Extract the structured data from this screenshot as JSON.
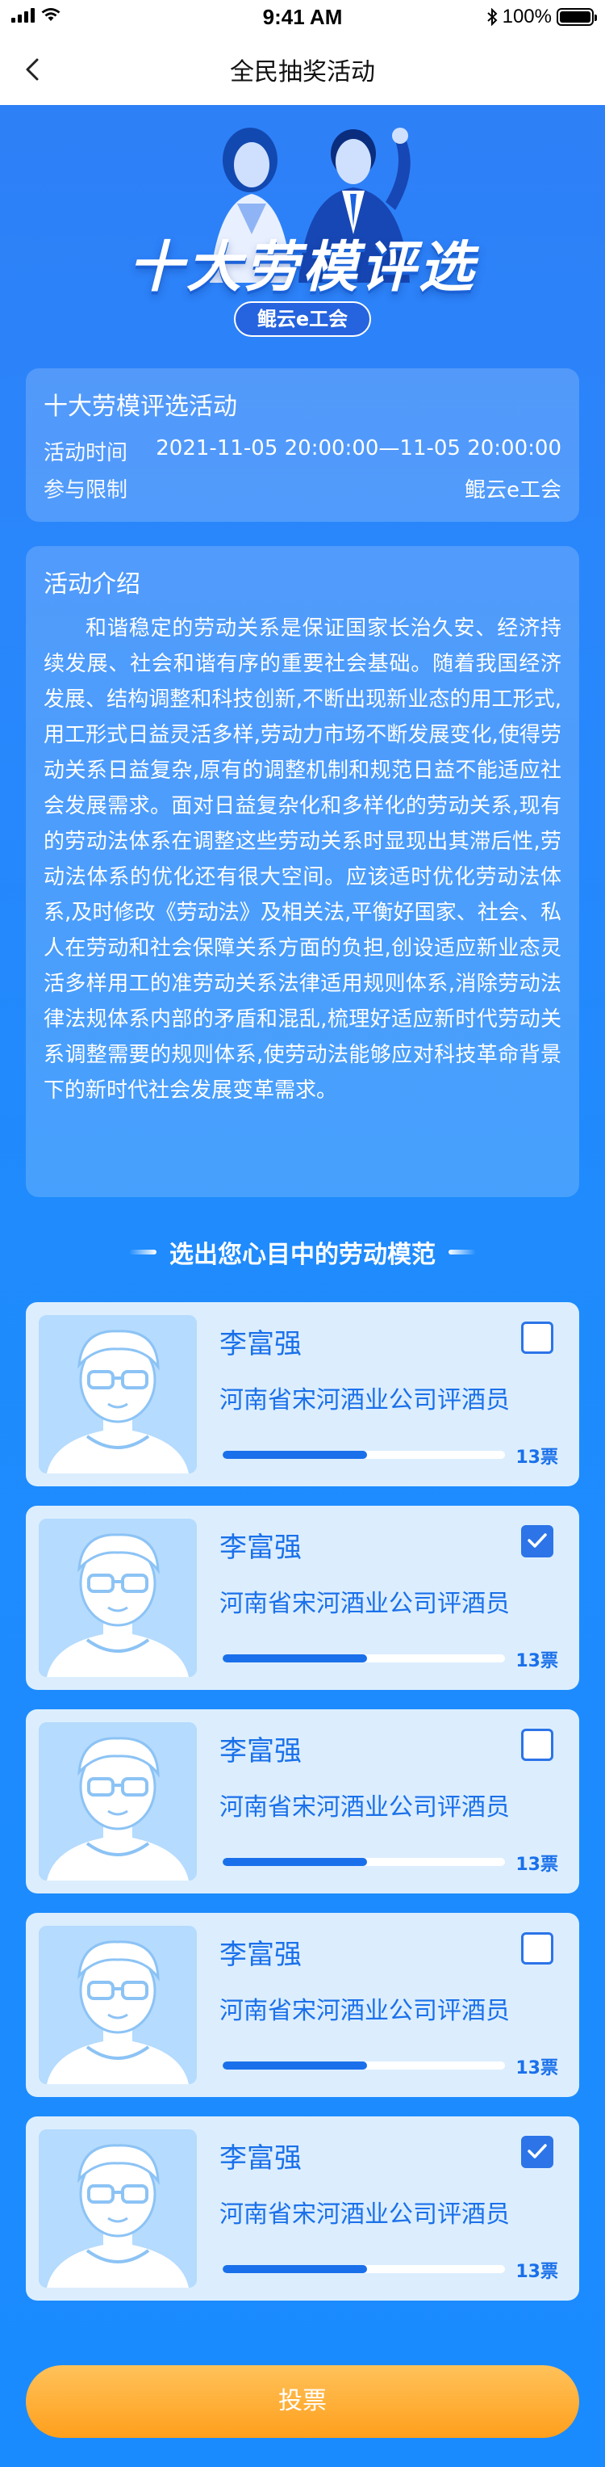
{
  "status_bar": {
    "time": "9:41 AM",
    "battery": "100%"
  },
  "nav": {
    "title": "全民抽奖活动"
  },
  "banner": {
    "title": "十大劳模评选",
    "badge": "鲲云e工会"
  },
  "info": {
    "title": "十大劳模评选活动",
    "time_label": "活动时间",
    "time_value": "2021-11-05 20:00:00—11-05 20:00:00",
    "limit_label": "参与限制",
    "limit_value": "鲲云e工会"
  },
  "intro": {
    "title": "活动介绍",
    "body": "和谐稳定的劳动关系是保证国家长治久安、经济持续发展、社会和谐有序的重要社会基础。随着我国经济发展、结构调整和科技创新,不断出现新业态的用工形式,用工形式日益灵活多样,劳动力市场不断发展变化,使得劳动关系日益复杂,原有的调整机制和规范日益不能适应社会发展需求。面对日益复杂化和多样化的劳动关系,现有的劳动法体系在调整这些劳动关系时显现出其滞后性,劳动法体系的优化还有很大空间。应该适时优化劳动法体系,及时修改《劳动法》及相关法,平衡好国家、社会、私人在劳动和社会保障关系方面的负担,创设适应新业态灵活多样用工的准劳动关系法律适用规则体系,消除劳动法律法规体系内部的矛盾和混乱,梳理好适应新时代劳动关系调整需要的规则体系,使劳动法能够应对科技革命背景下的新时代社会发展变革需求。"
  },
  "section": {
    "heading": "选出您心目中的劳动模范"
  },
  "candidates": [
    {
      "name": "李富强",
      "title": "河南省宋河酒业公司评酒员",
      "votes": "13票",
      "progress": 0.51,
      "checked": false
    },
    {
      "name": "李富强",
      "title": "河南省宋河酒业公司评酒员",
      "votes": "13票",
      "progress": 0.51,
      "checked": true
    },
    {
      "name": "李富强",
      "title": "河南省宋河酒业公司评酒员",
      "votes": "13票",
      "progress": 0.51,
      "checked": false
    },
    {
      "name": "李富强",
      "title": "河南省宋河酒业公司评酒员",
      "votes": "13票",
      "progress": 0.51,
      "checked": false
    },
    {
      "name": "李富强",
      "title": "河南省宋河酒业公司评酒员",
      "votes": "13票",
      "progress": 0.51,
      "checked": true
    }
  ],
  "vote_button": {
    "label": "投票"
  },
  "colors": {
    "accent": "#1a70ea",
    "button": "#ff9f1c",
    "card": "#dceefe"
  }
}
